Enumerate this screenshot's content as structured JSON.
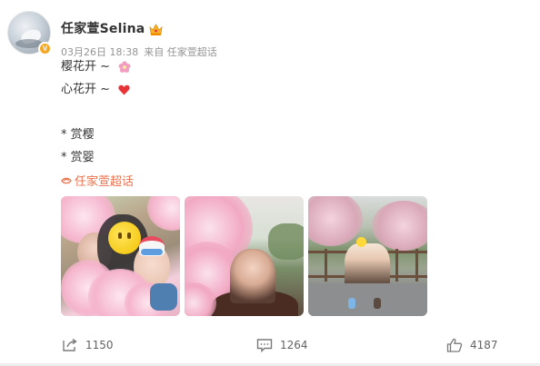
{
  "author": {
    "name": "任家萱Selina",
    "verified_badge": "V",
    "badge_color": "#f5a623"
  },
  "meta": {
    "date": "03月26日 18:38",
    "source": "来自 任家萱超话"
  },
  "content": {
    "line1": "樱花开 ~ ",
    "line2": "心花开 ~ ",
    "line3": "* 赏樱",
    "line4": "* 赏婴",
    "line1_icon": "cherry-blossom-icon",
    "line2_icon": "red-heart-icon"
  },
  "topic": {
    "label": "任家萱超话",
    "icon": "supertopic-eye-icon",
    "color": "#eb7350"
  },
  "photos": [
    "photo-selfie-with-baby",
    "photo-selfie-cherry-blossoms",
    "photo-family-by-railing"
  ],
  "actions": {
    "repost_count": "1150",
    "comment_count": "1264",
    "like_count": "4187"
  }
}
